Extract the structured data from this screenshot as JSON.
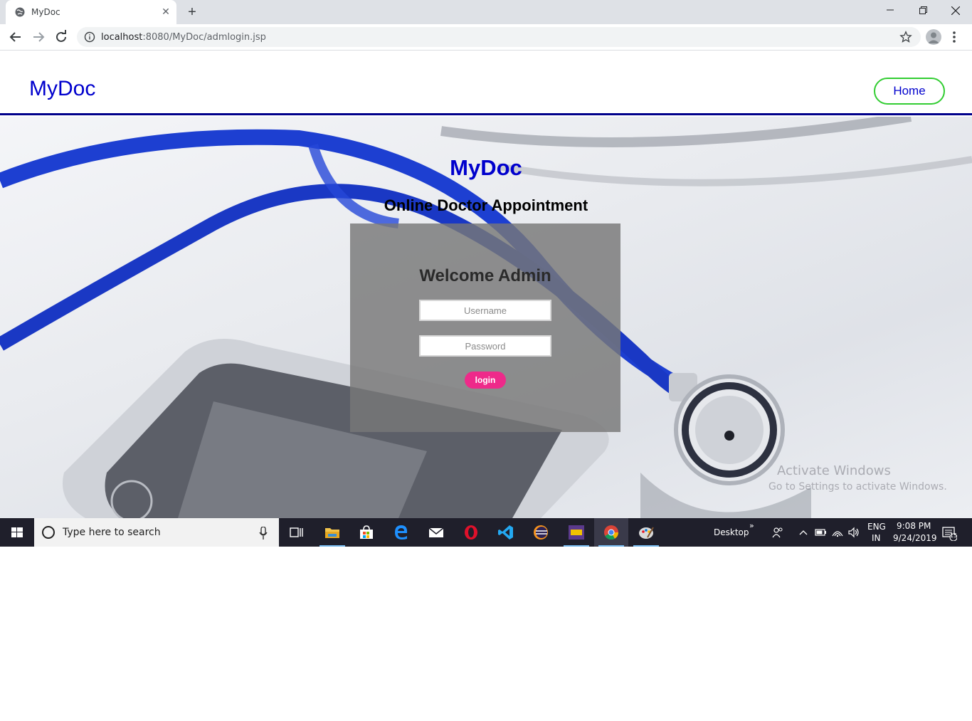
{
  "browser": {
    "tab_title": "MyDoc",
    "url_host": "localhost",
    "url_rest": ":8080/MyDoc/admlogin.jsp"
  },
  "header": {
    "brand": "MyDoc",
    "home_label": "Home"
  },
  "hero": {
    "title": "MyDoc",
    "subtitle": "Online Doctor Appointment"
  },
  "login": {
    "welcome": "Welcome Admin",
    "username_placeholder": "Username",
    "password_placeholder": "Password",
    "button_label": "login"
  },
  "watermark": {
    "line1": "Activate Windows",
    "line2": "Go to Settings to activate Windows."
  },
  "taskbar": {
    "search_placeholder": "Type here to search",
    "desktop_label": "Desktop",
    "lang_line1": "ENG",
    "lang_line2": "IN",
    "time": "9:08 PM",
    "date": "9/24/2019",
    "notification_count": "15",
    "apps": [
      "task-view",
      "file-explorer",
      "store",
      "edge",
      "mail",
      "opera",
      "vscode",
      "eclipse",
      "game",
      "chrome",
      "paint"
    ]
  },
  "colors": {
    "brand_blue": "#0000cd",
    "home_border": "#32cd32",
    "header_rule": "#00008b",
    "login_button": "#ee2a8a"
  }
}
